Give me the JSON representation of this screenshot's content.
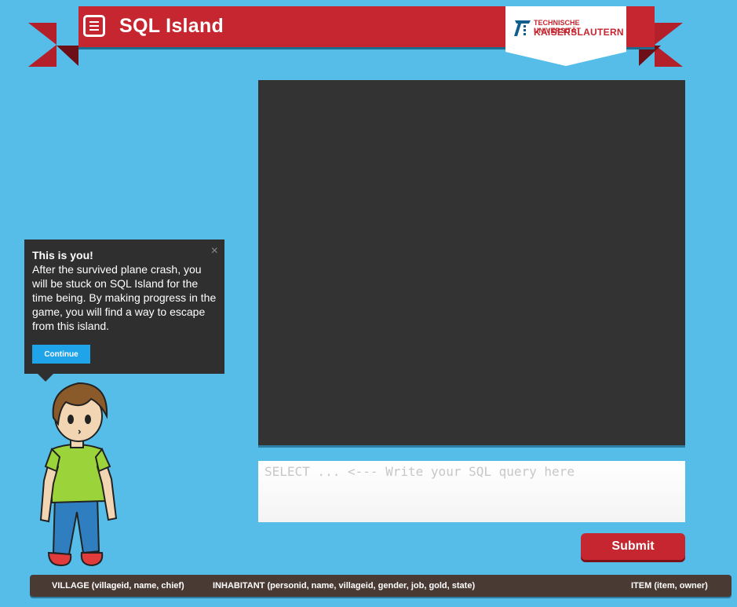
{
  "header": {
    "title": "SQL Island",
    "logo": {
      "line1": "TECHNISCHE UNIVERSITÄT",
      "line2": "KAISERSLAUTERN"
    }
  },
  "query_input": {
    "placeholder": "SELECT ... <--- Write your SQL query here",
    "value": ""
  },
  "submit_label": "Submit",
  "tooltip": {
    "title": "This is you!",
    "body": "After the survived plane crash, you will be stuck on SQL Island for the time being. By making progress in the game, you will find a way to escape from this island.",
    "close_glyph": "×",
    "continue_label": "Continue"
  },
  "schema": {
    "village": "VILLAGE (villageid, name, chief)",
    "inhabitant": "INHABITANT (personid, name, villageid, gender, job, gold, state)",
    "item": "ITEM (item, owner)"
  },
  "colors": {
    "background": "#56bde9",
    "banner_red": "#c5262f",
    "game_screen": "#333333",
    "tooltip_bg": "#2f2f2f",
    "continue_blue": "#1fa4ea",
    "schema_bar": "#4a3a34"
  }
}
